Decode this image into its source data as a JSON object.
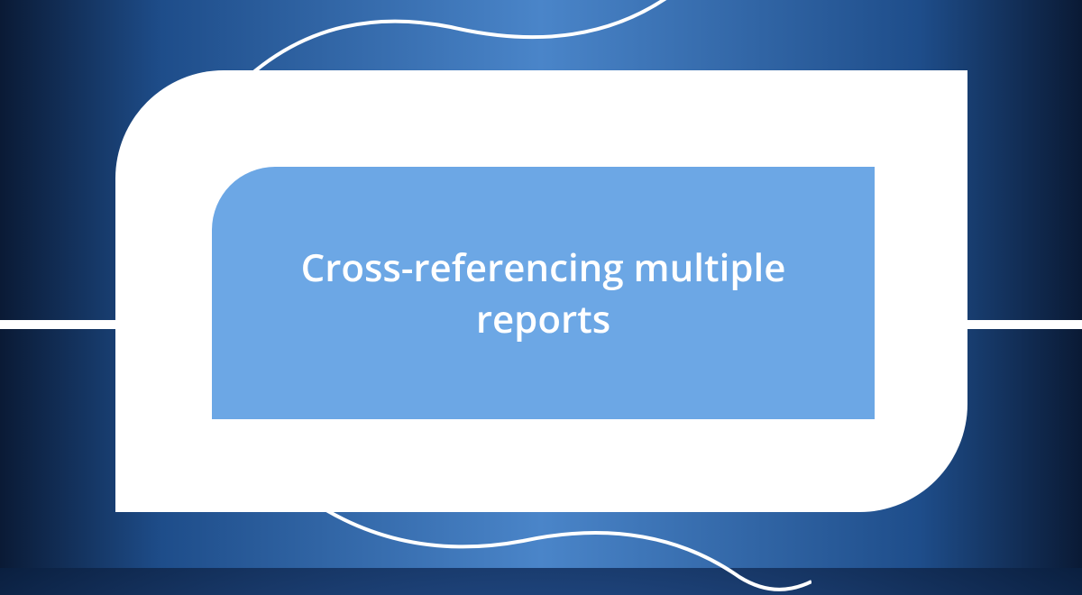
{
  "banner": {
    "title": "Cross-referencing multiple reports"
  }
}
